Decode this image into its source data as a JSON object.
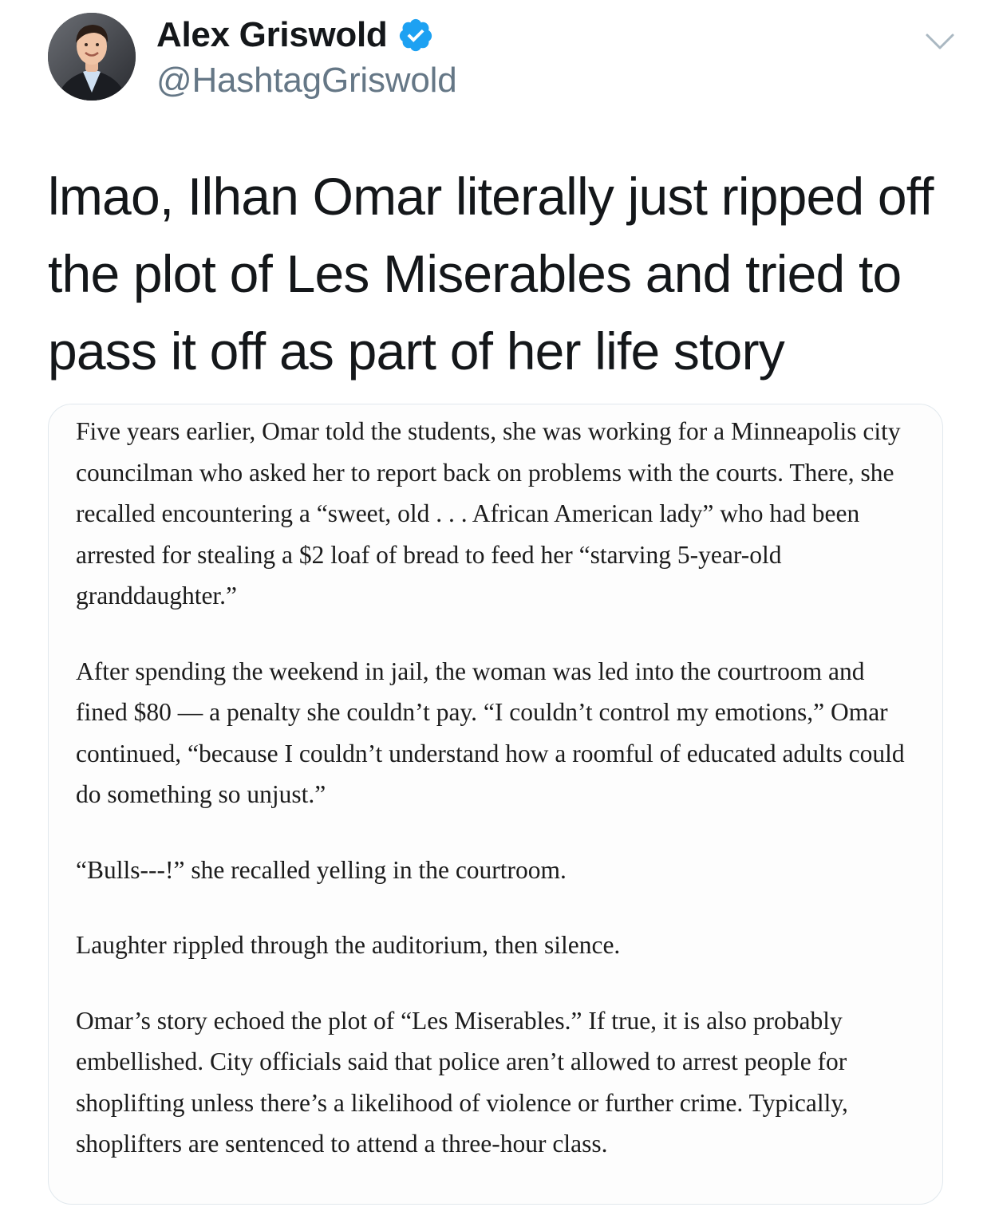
{
  "tweet": {
    "author": {
      "display_name": "Alex Griswold",
      "handle": "@HashtagGriswold",
      "verified": true,
      "verified_icon": "verified-badge-icon",
      "avatar_icon": "profile-photo"
    },
    "menu_icon": "chevron-down-icon",
    "text": "lmao, Ilhan Omar literally just ripped off the plot of Les Miserables and tried to pass it off as part of her life story",
    "colors": {
      "verified_blue": "#1DA1F2",
      "handle_gray": "#657786",
      "text": "#14171A",
      "border": "#E1E8ED"
    }
  },
  "media": {
    "paragraphs": [
      "Five years earlier, Omar told the students, she was working for a Minneapolis city councilman who asked her to report back on problems with the courts. There, she recalled encountering a “sweet, old . . . African American lady” who had been arrested for stealing a $2 loaf of bread to feed her “starving 5-year-old granddaughter.”",
      "After spending the weekend in jail, the woman was led into the courtroom and fined $80 — a penalty she couldn’t pay. “I couldn’t control my emotions,” Omar continued, “because I couldn’t understand how a roomful of educated adults could do something so unjust.”",
      "“Bulls---!” she recalled yelling in the courtroom.",
      "Laughter rippled through the auditorium, then silence.",
      "Omar’s story echoed the plot of “Les Miserables.” If true, it is also probably embellished. City officials said that police aren’t allowed to arrest people for shoplifting unless there’s a likelihood of violence or further crime. Typically, shoplifters are sentenced to attend a three-hour class."
    ]
  }
}
